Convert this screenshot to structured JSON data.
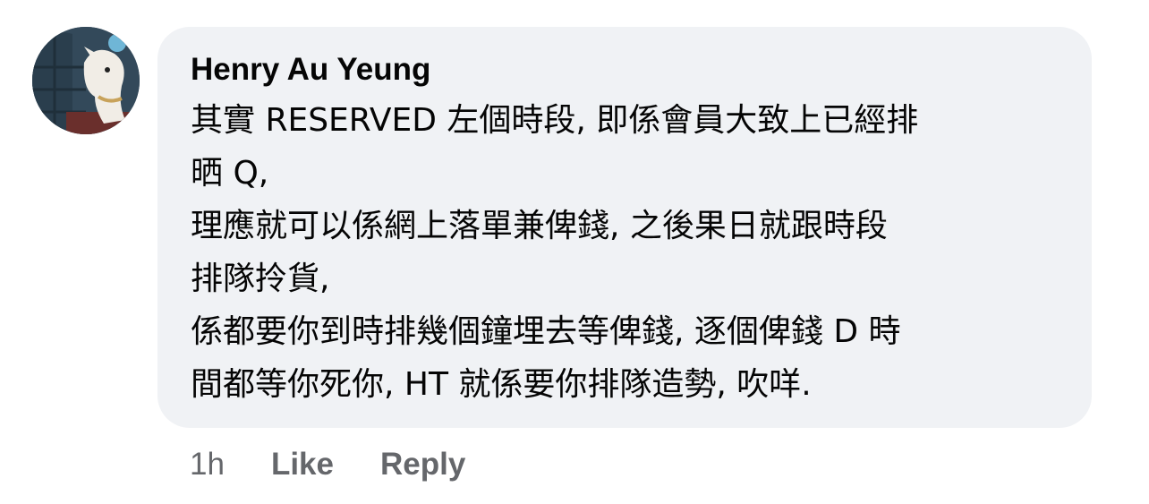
{
  "comment": {
    "author": "Henry Au Yeung",
    "body_lines": [
      "其實 RESERVED 左個時段, 即係會員大致上已經排",
      "晒 Q,",
      "理應就可以係網上落單兼俾錢, 之後果日就跟時段",
      "排隊拎貨,",
      "係都要你到時排幾個鐘埋去等俾錢, 逐個俾錢 D 時",
      "間都等你死你, HT 就係要你排隊造勢, 吹咩."
    ],
    "timestamp": "1h",
    "like_label": "Like",
    "reply_label": "Reply"
  },
  "colors": {
    "bubble_bg": "#f0f2f5",
    "text": "#050505",
    "secondary_text": "#65676b"
  }
}
